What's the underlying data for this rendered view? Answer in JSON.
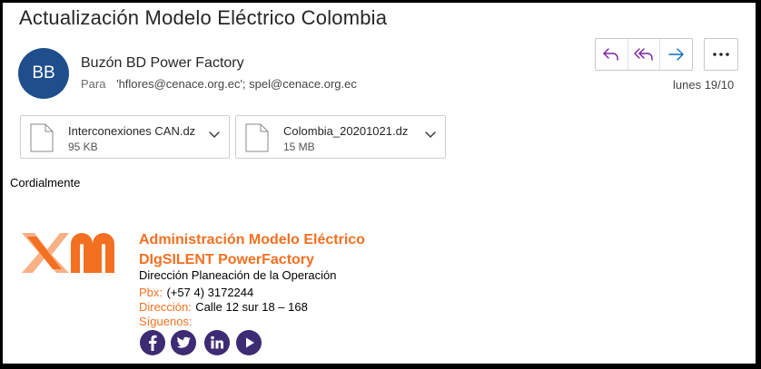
{
  "email": {
    "subject": "Actualización Modelo Eléctrico Colombia",
    "sender_initials": "BB",
    "sender_name": "Buzón BD Power Factory",
    "to_label": "Para",
    "to_value": "'hflores@cenace.org.ec'; spel@cenace.org.ec",
    "date": "lunes 19/10"
  },
  "actions": {
    "reply_icon": "reply-icon",
    "reply_all_icon": "reply-all-icon",
    "forward_icon": "forward-arrow-icon",
    "more_icon": "more-dots-icon"
  },
  "attachments": [
    {
      "name": "Interconexiones CAN.dz",
      "size": "95 KB"
    },
    {
      "name": "Colombia_20201021.dz",
      "size": "15 MB"
    }
  ],
  "body": {
    "greeting": "Cordialmente"
  },
  "signature": {
    "logo_text": "xm",
    "line1": "Administración Modelo Eléctrico",
    "line2": "DIgSILENT PowerFactory",
    "line3": "Dirección Planeación de la Operación",
    "pbx_label": "Pbx:",
    "pbx_value": "(+57 4) 3172244",
    "address_label": "Dirección:",
    "address_value": "Calle 12 sur 18 – 168",
    "follow_label": "Síguenos:",
    "social_icons": [
      "facebook-icon",
      "twitter-icon",
      "linkedin-icon",
      "youtube-icon"
    ]
  },
  "colors": {
    "accent_purple": "#7a1fa2",
    "accent_blue": "#0f6cbd",
    "avatar_blue": "#1f4e8c",
    "brand_orange": "#f37021",
    "social_purple": "#3d2b73"
  }
}
